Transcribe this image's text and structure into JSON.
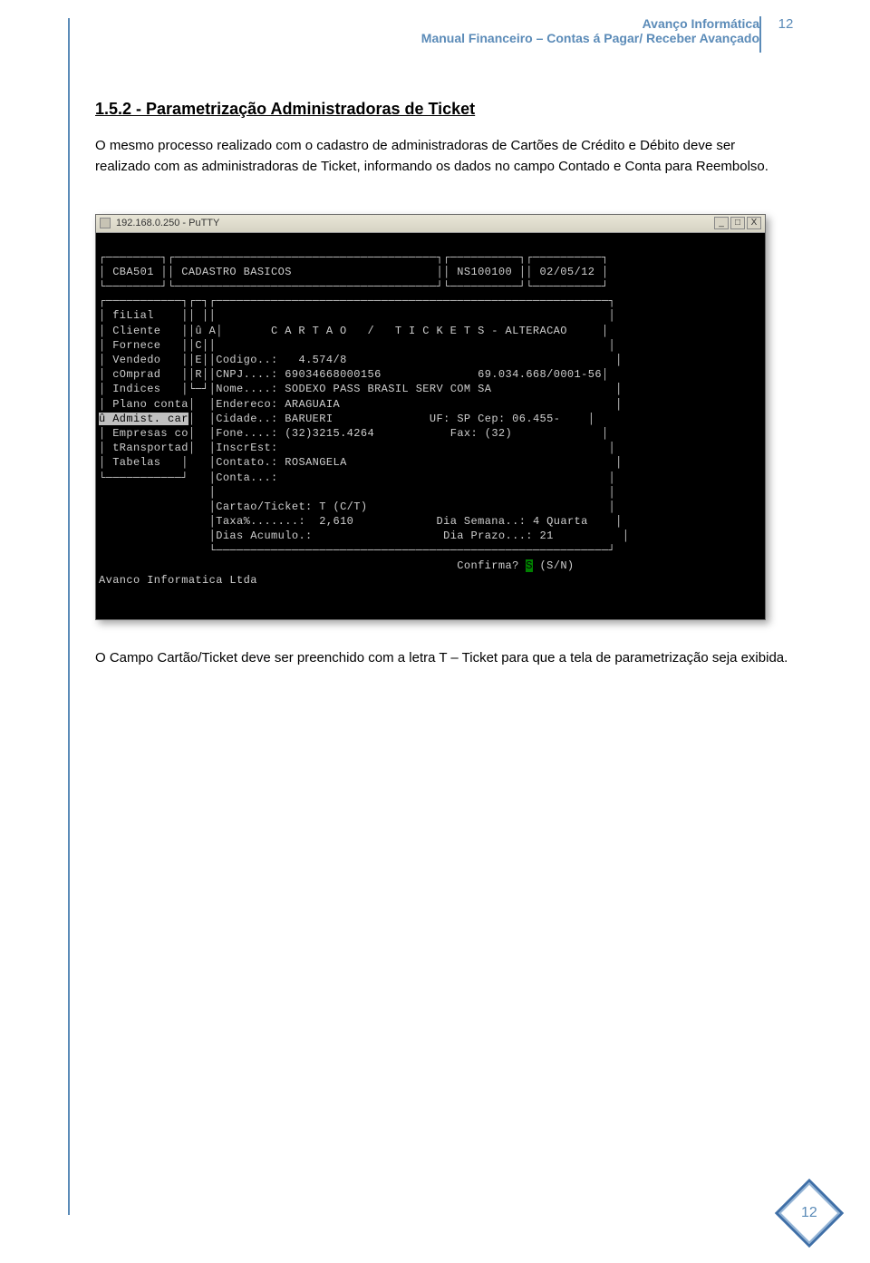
{
  "header": {
    "title1": "Avanço Informática",
    "title2": "Manual Financeiro – Contas á Pagar/ Receber Avançado",
    "page_num_top": "12"
  },
  "section": {
    "title": "1.5.2 - Parametrização Administradoras de Ticket",
    "para1": "O mesmo processo realizado com o cadastro de administradoras de Cartões de Crédito e Débito deve ser realizado com as administradoras de Ticket, informando os dados no campo Contado e Conta para Reembolso.",
    "para2": "O Campo Cartão/Ticket deve ser preenchido com a letra T – Ticket para que a tela de parametrização seja exibida."
  },
  "terminal": {
    "window_title": "192.168.0.250 - PuTTY",
    "header_code": "CBA501",
    "header_label": "CADASTRO BASICOS",
    "header_ns": "NS100100",
    "header_date": "02/05/12",
    "left_menu": [
      "fiLial",
      "Cliente",
      "Fornece",
      "Vendedo",
      "cOmprad",
      "Indices",
      "Plano conta",
      "Admist. car",
      "Empresas co",
      "tRansportad",
      "Tabelas"
    ],
    "left_col2": [
      "û A",
      "",
      "C",
      "E",
      "R",
      "",
      "",
      "",
      "",
      "",
      ""
    ],
    "modal_title": "C A R T A O   /   T I C K E T S - ALTERACAO",
    "fields": {
      "codigo_label": "Codigo..:",
      "codigo": "4.574/8",
      "cnpj_label": "CNPJ....:",
      "cnpj": "69034668000156",
      "cnpj_fmt": "69.034.668/0001-56",
      "nome_label": "Nome....:",
      "nome": "SODEXO PASS BRASIL SERV COM SA",
      "endereco_label": "Endereco:",
      "endereco": "ARAGUAIA",
      "cidade_label": "Cidade..:",
      "cidade": "BARUERI",
      "uf_label": "UF:",
      "uf": "SP",
      "cep_label": "Cep:",
      "cep": "06.455-",
      "fone_label": "Fone....:",
      "fone": "(32)3215.4264",
      "fax_label": "Fax:",
      "fax": "(32)",
      "inscrest_label": "InscrEst:",
      "contato_label": "Contato.:",
      "contato": "ROSANGELA",
      "conta_label": "Conta...:",
      "cartao_ticket_label": "Cartao/Ticket:",
      "cartao_ticket": "T (C/T)",
      "taxa_label": "Taxa%.......:",
      "taxa": "2,610",
      "dia_semana_label": "Dia Semana..:",
      "dia_semana": "4 Quarta",
      "dias_acumulo_label": "Dias Acumulo.:",
      "dia_prazo_label": "Dia Prazo...:",
      "dia_prazo": "21"
    },
    "confirm": {
      "label": "Confirma?",
      "value": "S",
      "hint": "(S/N)"
    },
    "footer": "Avanco Informatica Ltda"
  },
  "footer": {
    "page_num_bottom": "12"
  }
}
